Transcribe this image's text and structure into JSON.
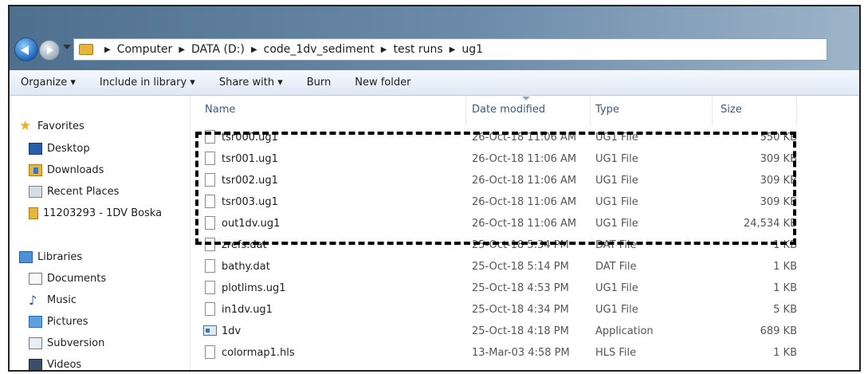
{
  "address_bar": {
    "crumbs": [
      "Computer",
      "DATA (D:)",
      "code_1dv_sediment",
      "test runs",
      "ug1"
    ]
  },
  "toolbar": {
    "organize": "Organize ▾",
    "include": "Include in library ▾",
    "share": "Share with ▾",
    "burn": "Burn",
    "new_folder": "New folder"
  },
  "sidebar": {
    "favorites": "Favorites",
    "desktop": "Desktop",
    "downloads": "Downloads",
    "recent": "Recent Places",
    "project": "11203293 - 1DV Boska",
    "libraries": "Libraries",
    "documents": "Documents",
    "music": "Music",
    "pictures": "Pictures",
    "subversion": "Subversion",
    "videos": "Videos"
  },
  "columns": {
    "name": "Name",
    "date": "Date modified",
    "type": "Type",
    "size": "Size"
  },
  "files": [
    {
      "name": "tsr000.ug1",
      "date": "26-Oct-18 11:06 AM",
      "type": "UG1 File",
      "size": "550 KB",
      "icon": "file-icon"
    },
    {
      "name": "tsr001.ug1",
      "date": "26-Oct-18 11:06 AM",
      "type": "UG1 File",
      "size": "309 KB",
      "icon": "file-icon"
    },
    {
      "name": "tsr002.ug1",
      "date": "26-Oct-18 11:06 AM",
      "type": "UG1 File",
      "size": "309 KB",
      "icon": "file-icon"
    },
    {
      "name": "tsr003.ug1",
      "date": "26-Oct-18 11:06 AM",
      "type": "UG1 File",
      "size": "309 KB",
      "icon": "file-icon"
    },
    {
      "name": "out1dv.ug1",
      "date": "26-Oct-18 11:06 AM",
      "type": "UG1 File",
      "size": "24,534 KB",
      "icon": "file-icon"
    },
    {
      "name": "zrefs.dat",
      "date": "25-Oct-18 5:34 PM",
      "type": "DAT File",
      "size": "1 KB",
      "icon": "file-icon"
    },
    {
      "name": "bathy.dat",
      "date": "25-Oct-18 5:14 PM",
      "type": "DAT File",
      "size": "1 KB",
      "icon": "file-icon"
    },
    {
      "name": "plotlims.ug1",
      "date": "25-Oct-18 4:53 PM",
      "type": "UG1 File",
      "size": "1 KB",
      "icon": "file-icon"
    },
    {
      "name": "in1dv.ug1",
      "date": "25-Oct-18 4:34 PM",
      "type": "UG1 File",
      "size": "5 KB",
      "icon": "file-icon"
    },
    {
      "name": "1dv",
      "date": "25-Oct-18 4:18 PM",
      "type": "Application",
      "size": "689 KB",
      "icon": "application-icon"
    },
    {
      "name": "colormap1.hls",
      "date": "13-Mar-03 4:58 PM",
      "type": "HLS File",
      "size": "1 KB",
      "icon": "file-icon"
    }
  ]
}
